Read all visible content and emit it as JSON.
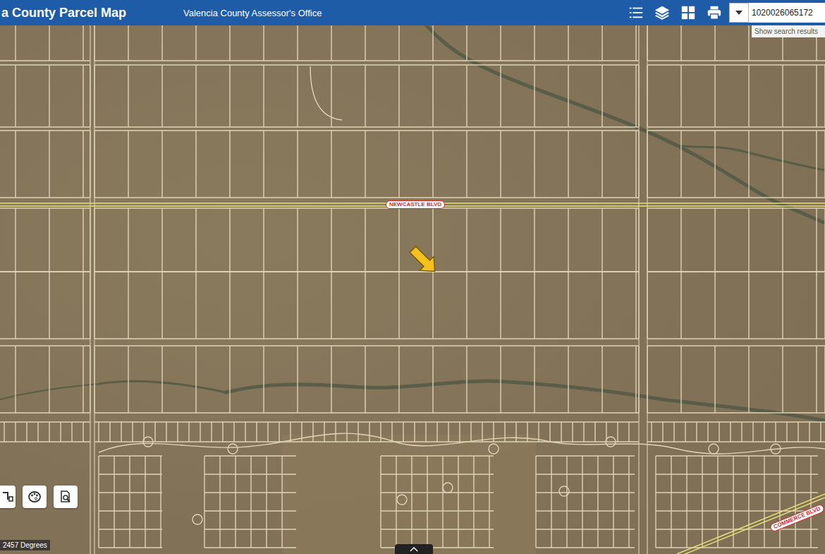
{
  "header": {
    "title": "a County Parcel Map",
    "subtitle": "Valencia County Assessor's Office"
  },
  "search": {
    "value": "1020026065172",
    "hint": "Show search results"
  },
  "roads": [
    {
      "label": "NEWCASTLE BLVD"
    },
    {
      "label": "COMMERCE BLVD"
    }
  ],
  "scale": {
    "text": "2457 Degrees"
  }
}
